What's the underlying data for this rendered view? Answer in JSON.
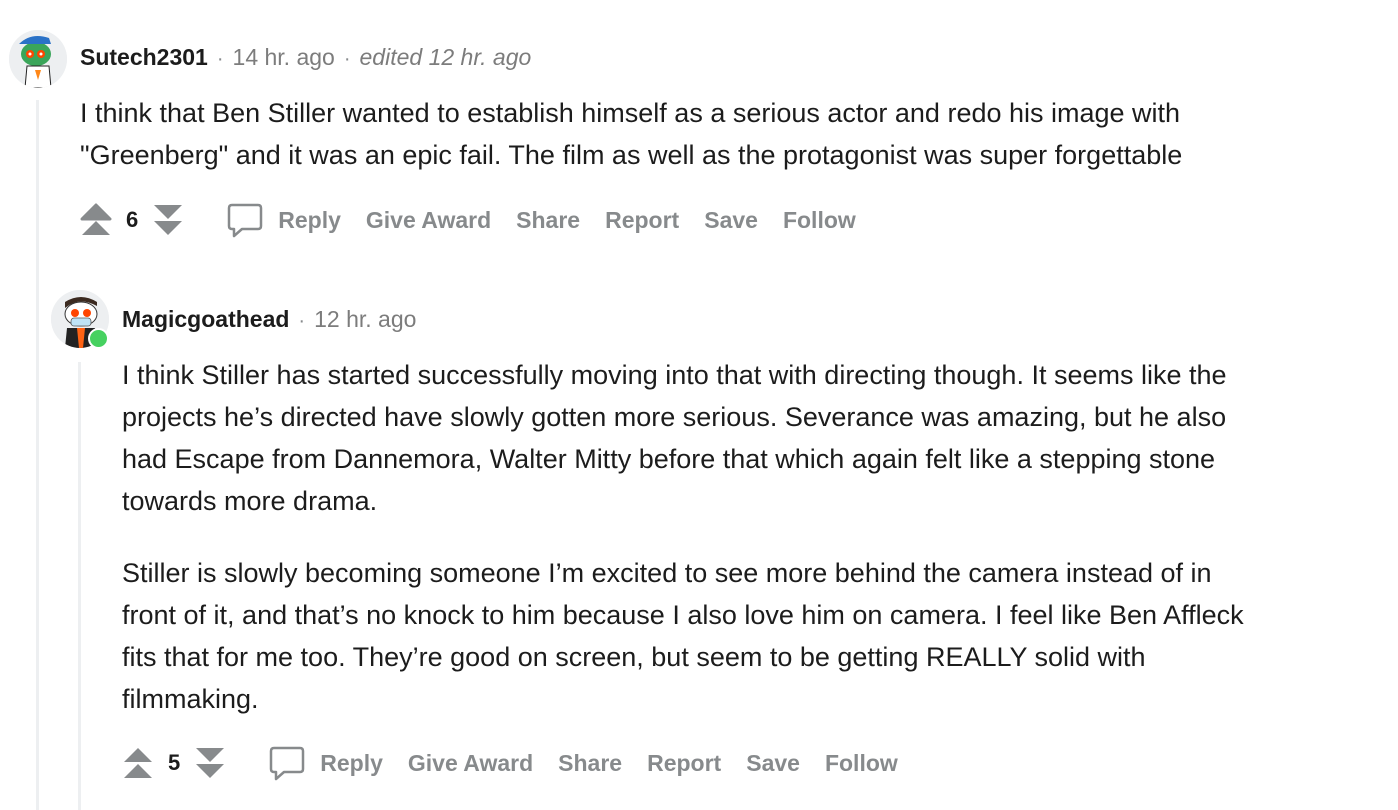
{
  "top_comment": {
    "author": "Sutech2301",
    "time": "14 hr. ago",
    "edited": "edited 12 hr. ago",
    "body": [
      "I think that Ben Stiller wanted to establish himself as a serious actor and redo his image with",
      "\"Greenberg\" and it was an epic fail. The film as well as the protagonist was super forgettable"
    ],
    "score": "6",
    "actions": {
      "reply": "Reply",
      "award": "Give Award",
      "share": "Share",
      "report": "Report",
      "save": "Save",
      "follow": "Follow"
    }
  },
  "reply_comment": {
    "author": "Magicgoathead",
    "time": "12 hr. ago",
    "paragraphs": [
      [
        "I think Stiller has started successfully moving into that with directing though. It seems like the",
        "projects he’s directed have slowly gotten more serious. Severance was amazing, but he also",
        "had Escape from Dannemora, Walter Mitty before that which again felt like a stepping stone",
        "towards more drama."
      ],
      [
        "Stiller is slowly becoming someone I’m excited to see more behind the camera instead of in",
        "front of it, and that’s no knock to him because I also love him on camera. I feel like Ben Affleck",
        "fits that for me too. They’re good on screen, but seem to be getting REALLY solid with",
        "filmmaking."
      ]
    ],
    "score": "5",
    "actions": {
      "reply": "Reply",
      "award": "Give Award",
      "share": "Share",
      "report": "Report",
      "save": "Save",
      "follow": "Follow"
    }
  },
  "colors": {
    "online": "#46d160",
    "meta_gray": "#878a8c",
    "thread_line": "#edeff1"
  }
}
